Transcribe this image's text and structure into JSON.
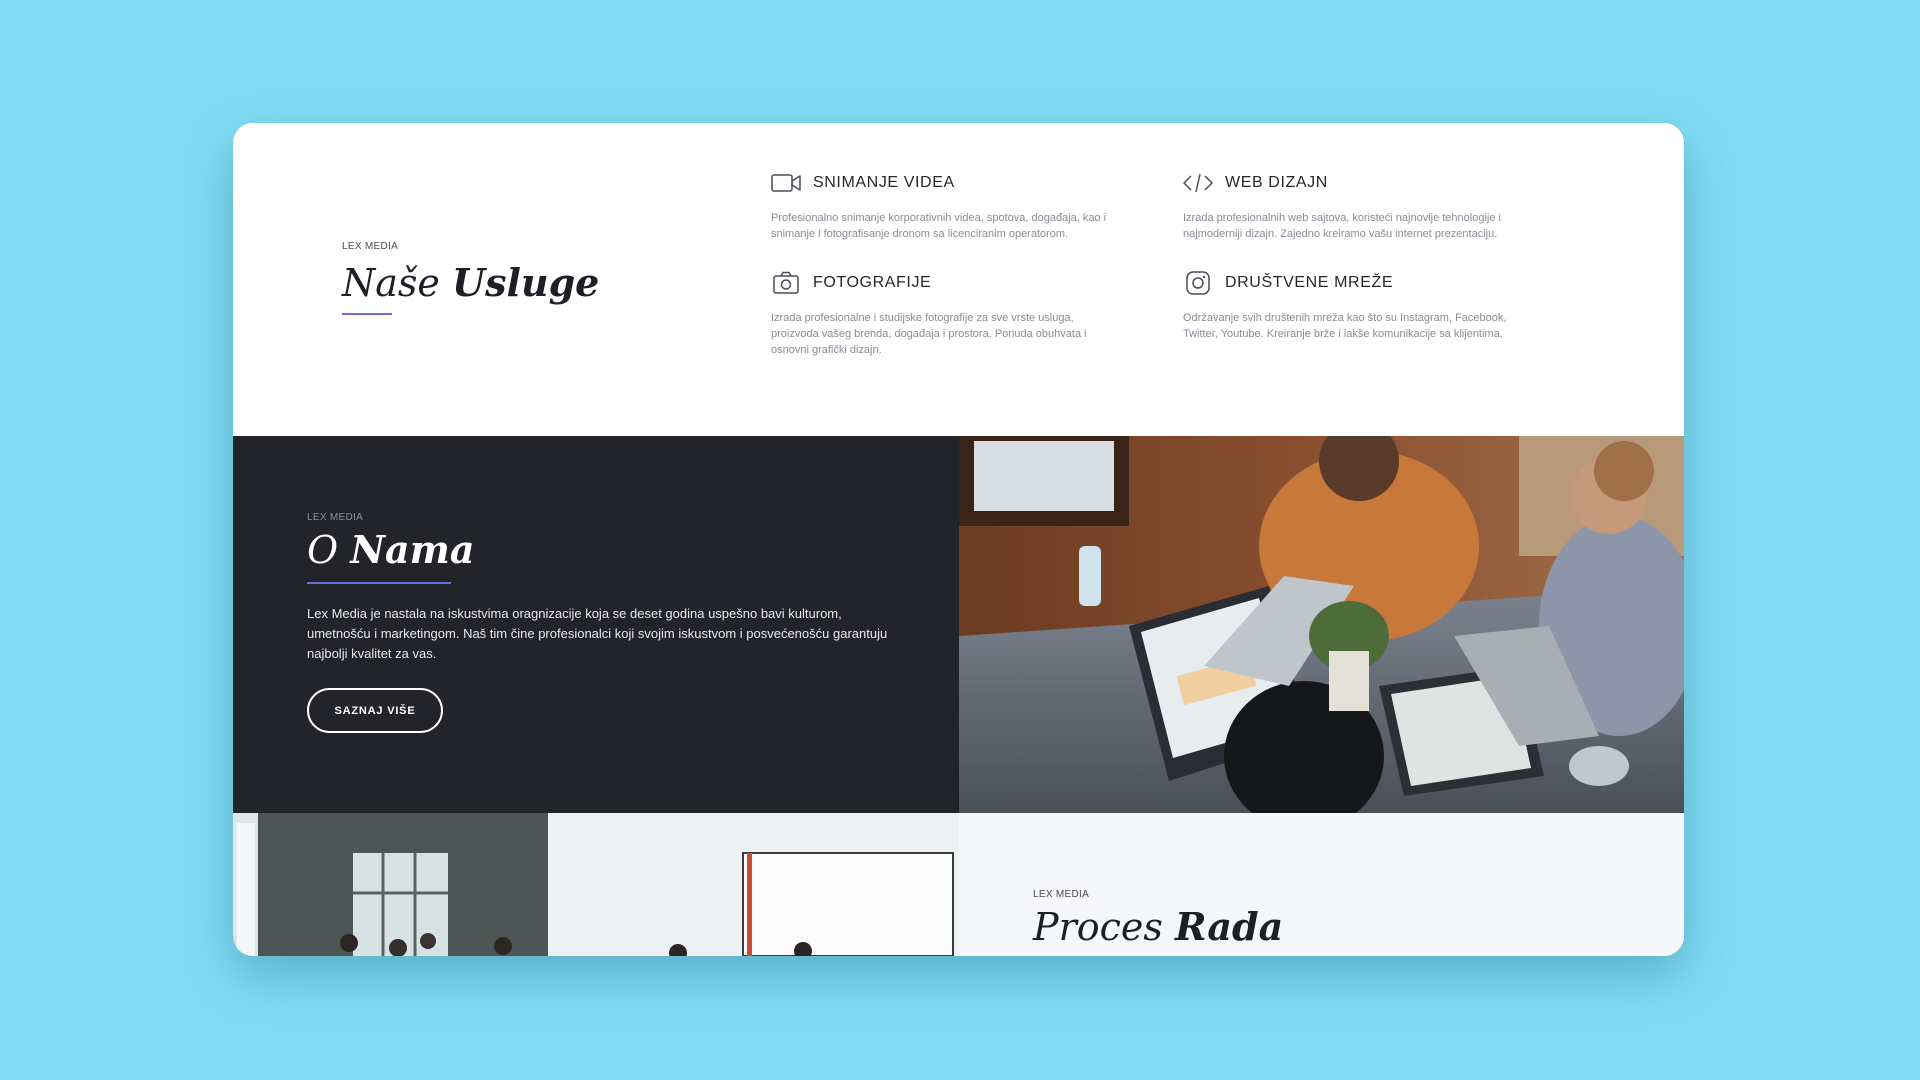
{
  "services": {
    "kicker": "LEX MEDIA",
    "title_light": "Naše",
    "title_bold": "Usluge",
    "items": [
      {
        "icon": "video-camera-icon",
        "title": "SNIMANJE VIDEA",
        "desc": "Profesionalno snimanje korporativnih videa, spotova, događaja, kao i snimanje i fotografisanje dronom sa licenciranim operatorom."
      },
      {
        "icon": "code-icon",
        "title": "WEB DIZAJN",
        "desc": "Izrada profesionalnih web sajtova, koristeći najnovije tehnologije i najmoderniji dizajn. Zajedno kreiramo vašu internet prezentaciju."
      },
      {
        "icon": "camera-icon",
        "title": "FOTOGRAFIJE",
        "desc": "Izrada profesionalne i studijske fotografije za sve vrste usluga, proizvoda vašeg brenda, događaja i prostora. Ponuda obuhvata i osnovni grafički dizajn."
      },
      {
        "icon": "instagram-icon",
        "title": "DRUŠTVENE MREŽE",
        "desc": "Održavanje svih društenih mreža kao što su Instagram, Facebook, Twitter, Youtube. Kreiranje brže i lakše komunikacije sa klijentima."
      }
    ]
  },
  "about": {
    "kicker": "LEX MEDIA",
    "title_light": "O",
    "title_bold": "Nama",
    "text": "Lex Media je nastala na iskustvima oragnizacije koja se deset godina uspešno bavi kulturom, umetnošću i marketingom. Naš tim čine profesionalci koji svojim iskustvom i posvećenošću garantuju najbolji kvalitet za vas.",
    "button": "SAZNAJ VIŠE"
  },
  "process": {
    "kicker": "LEX MEDIA",
    "title_light": "Proces",
    "title_bold": "Rada"
  },
  "colors": {
    "background": "#7fdcf4",
    "dark": "#22242a",
    "accent": "#6b6ddb"
  }
}
